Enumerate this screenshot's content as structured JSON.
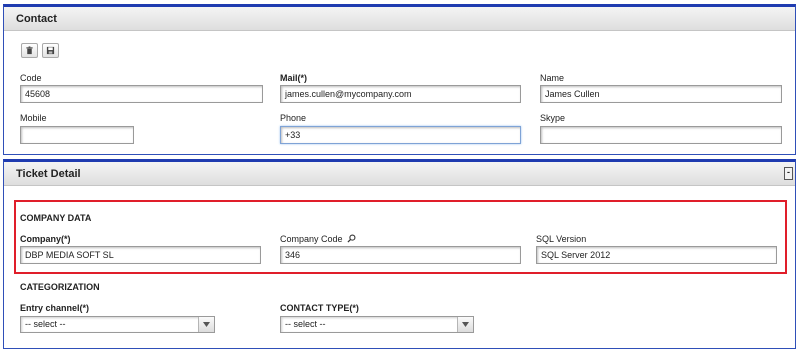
{
  "contact": {
    "title": "Contact",
    "toolbar": {
      "delete_icon": "trash-icon",
      "save_icon": "save-icon"
    },
    "fields": {
      "code": {
        "label": "Code",
        "value": "45608"
      },
      "mail": {
        "label": "Mail(*)",
        "value": "james.cullen@mycompany.com"
      },
      "name": {
        "label": "Name",
        "value": "James Cullen"
      },
      "mobile": {
        "label": "Mobile",
        "value": ""
      },
      "phone": {
        "label": "Phone",
        "value": "+33"
      },
      "skype": {
        "label": "Skype",
        "value": ""
      }
    }
  },
  "ticket": {
    "title": "Ticket Detail",
    "collapse_label": "-",
    "company_data": {
      "title": "COMPANY DATA",
      "company": {
        "label": "Company(*)",
        "value": "DBP MEDIA SOFT SL"
      },
      "company_code": {
        "label": "Company Code",
        "value": "346",
        "icon": "search-icon"
      },
      "sql_version": {
        "label": "SQL Version",
        "value": "SQL Server 2012"
      }
    },
    "categorization": {
      "title": "CATEGORIZATION",
      "entry_channel": {
        "label": "Entry channel(*)",
        "selected": "-- select --"
      },
      "contact_type": {
        "label": "CONTACT TYPE(*)",
        "selected": "-- select --"
      }
    }
  },
  "colors": {
    "panel_border": "#1f3bb0",
    "highlight": "#e01e2a"
  }
}
